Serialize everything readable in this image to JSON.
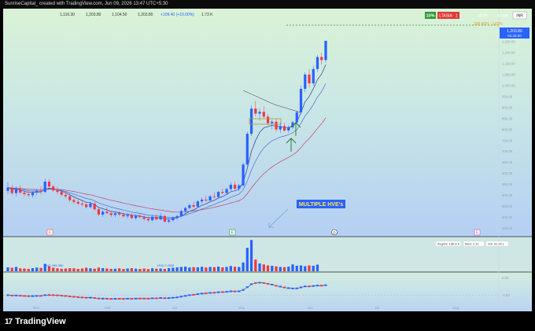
{
  "header": {
    "caption": "SunriseCapital_ created with TradingView.com, Jun 09, 2026 13:47 UTC+5:30"
  },
  "ohlc_readout": {
    "open": "1,116.30",
    "high": "1,203.80",
    "low": "1,104.50",
    "close": "1,203.80",
    "change": "+109.40 (+10.00%)",
    "extra": "1.73 K"
  },
  "toolbar": {
    "pct_badge": "10%",
    "ltasia_badge": "LTASIA · 1",
    "stat1": "431%",
    "stat2": "4.16%",
    "currency_badge": "INR",
    "orange_label": "248.40%  ↑142%"
  },
  "price_tags": {
    "last_price": "1,203.80",
    "countdown": "01:42:20"
  },
  "annotation": {
    "text": "MULTIPLE HVE's"
  },
  "event_markers": [
    "E",
    "E",
    "D",
    "E"
  ],
  "volume_panel": {
    "labels": [
      "AvgVol: 136.8 K",
      "Med: 2.11",
      "Vol: 31.92 L"
    ],
    "hvq_labels": [
      "HVQ  495.36K",
      "HVQ  1.06M"
    ]
  },
  "x_axis_labels": [
    "Nov",
    "Mar",
    "Apr",
    "May",
    "Jun",
    "Jul",
    "Aug"
  ],
  "colors": {
    "up": "#2962ff",
    "down": "#f23645",
    "ema_fast": "#1f3fa8",
    "ema_mid": "#4a6fd8",
    "ema_slow": "#c0446a",
    "annotation_bg": "#2962ff",
    "annotation_text": "#ffe94d",
    "arrow": "#2e7d32"
  },
  "chart_data": {
    "type": "candlestick",
    "last_close": 1203.8,
    "candles": [
      {
        "o": 520,
        "h": 560,
        "l": 505,
        "c": 535
      },
      {
        "o": 535,
        "h": 548,
        "l": 500,
        "c": 510
      },
      {
        "o": 510,
        "h": 540,
        "l": 495,
        "c": 528
      },
      {
        "o": 528,
        "h": 545,
        "l": 505,
        "c": 512
      },
      {
        "o": 512,
        "h": 530,
        "l": 495,
        "c": 505
      },
      {
        "o": 505,
        "h": 522,
        "l": 490,
        "c": 500
      },
      {
        "o": 500,
        "h": 520,
        "l": 488,
        "c": 512
      },
      {
        "o": 512,
        "h": 530,
        "l": 500,
        "c": 520
      },
      {
        "o": 520,
        "h": 540,
        "l": 505,
        "c": 515
      },
      {
        "o": 515,
        "h": 575,
        "l": 510,
        "c": 562
      },
      {
        "o": 562,
        "h": 575,
        "l": 530,
        "c": 540
      },
      {
        "o": 540,
        "h": 548,
        "l": 515,
        "c": 522
      },
      {
        "o": 522,
        "h": 538,
        "l": 505,
        "c": 515
      },
      {
        "o": 515,
        "h": 530,
        "l": 495,
        "c": 502
      },
      {
        "o": 502,
        "h": 520,
        "l": 485,
        "c": 495
      },
      {
        "o": 495,
        "h": 510,
        "l": 470,
        "c": 478
      },
      {
        "o": 478,
        "h": 492,
        "l": 460,
        "c": 470
      },
      {
        "o": 470,
        "h": 486,
        "l": 455,
        "c": 462
      },
      {
        "o": 462,
        "h": 480,
        "l": 450,
        "c": 458
      },
      {
        "o": 458,
        "h": 470,
        "l": 440,
        "c": 446
      },
      {
        "o": 446,
        "h": 470,
        "l": 440,
        "c": 462
      },
      {
        "o": 462,
        "h": 470,
        "l": 430,
        "c": 436
      },
      {
        "o": 436,
        "h": 446,
        "l": 405,
        "c": 412
      },
      {
        "o": 412,
        "h": 432,
        "l": 402,
        "c": 425
      },
      {
        "o": 425,
        "h": 445,
        "l": 415,
        "c": 418
      },
      {
        "o": 418,
        "h": 430,
        "l": 400,
        "c": 410
      },
      {
        "o": 410,
        "h": 425,
        "l": 400,
        "c": 418
      },
      {
        "o": 418,
        "h": 428,
        "l": 405,
        "c": 412
      },
      {
        "o": 412,
        "h": 422,
        "l": 398,
        "c": 404
      },
      {
        "o": 404,
        "h": 418,
        "l": 395,
        "c": 410
      },
      {
        "o": 410,
        "h": 420,
        "l": 390,
        "c": 396
      },
      {
        "o": 396,
        "h": 414,
        "l": 388,
        "c": 405
      },
      {
        "o": 405,
        "h": 420,
        "l": 398,
        "c": 400
      },
      {
        "o": 400,
        "h": 410,
        "l": 385,
        "c": 392
      },
      {
        "o": 392,
        "h": 402,
        "l": 378,
        "c": 386
      },
      {
        "o": 386,
        "h": 410,
        "l": 382,
        "c": 402
      },
      {
        "o": 402,
        "h": 412,
        "l": 385,
        "c": 390
      },
      {
        "o": 390,
        "h": 420,
        "l": 385,
        "c": 405
      },
      {
        "o": 405,
        "h": 412,
        "l": 375,
        "c": 380
      },
      {
        "o": 380,
        "h": 396,
        "l": 372,
        "c": 386
      },
      {
        "o": 386,
        "h": 405,
        "l": 380,
        "c": 398
      },
      {
        "o": 398,
        "h": 412,
        "l": 388,
        "c": 405
      },
      {
        "o": 405,
        "h": 435,
        "l": 400,
        "c": 428
      },
      {
        "o": 428,
        "h": 448,
        "l": 420,
        "c": 442
      },
      {
        "o": 442,
        "h": 462,
        "l": 435,
        "c": 455
      },
      {
        "o": 455,
        "h": 470,
        "l": 440,
        "c": 448
      },
      {
        "o": 448,
        "h": 480,
        "l": 445,
        "c": 472
      },
      {
        "o": 472,
        "h": 490,
        "l": 462,
        "c": 480
      },
      {
        "o": 480,
        "h": 498,
        "l": 470,
        "c": 476
      },
      {
        "o": 476,
        "h": 500,
        "l": 472,
        "c": 495
      },
      {
        "o": 495,
        "h": 512,
        "l": 485,
        "c": 492
      },
      {
        "o": 492,
        "h": 520,
        "l": 488,
        "c": 515
      },
      {
        "o": 515,
        "h": 530,
        "l": 505,
        "c": 510
      },
      {
        "o": 510,
        "h": 535,
        "l": 505,
        "c": 528
      },
      {
        "o": 528,
        "h": 560,
        "l": 520,
        "c": 548
      },
      {
        "o": 548,
        "h": 562,
        "l": 525,
        "c": 530
      },
      {
        "o": 530,
        "h": 552,
        "l": 520,
        "c": 545
      },
      {
        "o": 545,
        "h": 650,
        "l": 540,
        "c": 640
      },
      {
        "o": 640,
        "h": 790,
        "l": 635,
        "c": 780
      },
      {
        "o": 780,
        "h": 910,
        "l": 770,
        "c": 895
      },
      {
        "o": 895,
        "h": 930,
        "l": 860,
        "c": 872
      },
      {
        "o": 872,
        "h": 895,
        "l": 840,
        "c": 880
      },
      {
        "o": 880,
        "h": 905,
        "l": 850,
        "c": 858
      },
      {
        "o": 858,
        "h": 870,
        "l": 820,
        "c": 828
      },
      {
        "o": 828,
        "h": 845,
        "l": 800,
        "c": 835
      },
      {
        "o": 835,
        "h": 850,
        "l": 790,
        "c": 800
      },
      {
        "o": 800,
        "h": 830,
        "l": 785,
        "c": 815
      },
      {
        "o": 815,
        "h": 830,
        "l": 790,
        "c": 795
      },
      {
        "o": 795,
        "h": 818,
        "l": 785,
        "c": 810
      },
      {
        "o": 810,
        "h": 840,
        "l": 800,
        "c": 832
      },
      {
        "o": 832,
        "h": 885,
        "l": 825,
        "c": 878
      },
      {
        "o": 878,
        "h": 1000,
        "l": 870,
        "c": 985
      },
      {
        "o": 985,
        "h": 1060,
        "l": 970,
        "c": 1050
      },
      {
        "o": 1050,
        "h": 1075,
        "l": 990,
        "c": 1010
      },
      {
        "o": 1010,
        "h": 1090,
        "l": 1000,
        "c": 1075
      },
      {
        "o": 1075,
        "h": 1140,
        "l": 1060,
        "c": 1130
      },
      {
        "o": 1130,
        "h": 1150,
        "l": 1095,
        "c": 1116
      },
      {
        "o": 1116,
        "h": 1204,
        "l": 1104,
        "c": 1203.8
      }
    ],
    "volume": [
      20,
      18,
      22,
      15,
      14,
      12,
      16,
      19,
      17,
      38,
      26,
      18,
      15,
      13,
      14,
      16,
      15,
      12,
      14,
      18,
      15,
      13,
      19,
      16,
      14,
      12,
      13,
      15,
      12,
      14,
      16,
      13,
      12,
      14,
      11,
      15,
      13,
      14,
      12,
      16,
      18,
      20,
      22,
      24,
      19,
      21,
      20,
      23,
      19,
      22,
      21,
      24,
      20,
      22,
      27,
      23,
      22,
      45,
      120,
      160,
      60,
      40,
      35,
      30,
      28,
      25,
      22,
      21,
      24,
      35,
      28,
      30,
      26,
      30,
      28,
      34
    ],
    "volume_ylim": [
      0,
      165
    ],
    "ylim": [
      340,
      1250
    ],
    "y_ticks": [
      1200,
      1150,
      1100,
      1050,
      1000,
      950,
      900,
      850,
      800,
      750,
      700,
      650,
      600,
      550,
      500,
      450,
      400,
      350
    ],
    "ema_periods": [
      "fast",
      "mid",
      "slow"
    ],
    "lower_ylim": [
      -1,
      1
    ],
    "lower_ticks": [
      "0.00",
      "-0.50"
    ],
    "x_labels": [
      "Nov",
      "Mar",
      "Apr",
      "May",
      "Jun",
      "Jul",
      "Aug"
    ],
    "grid": true
  }
}
